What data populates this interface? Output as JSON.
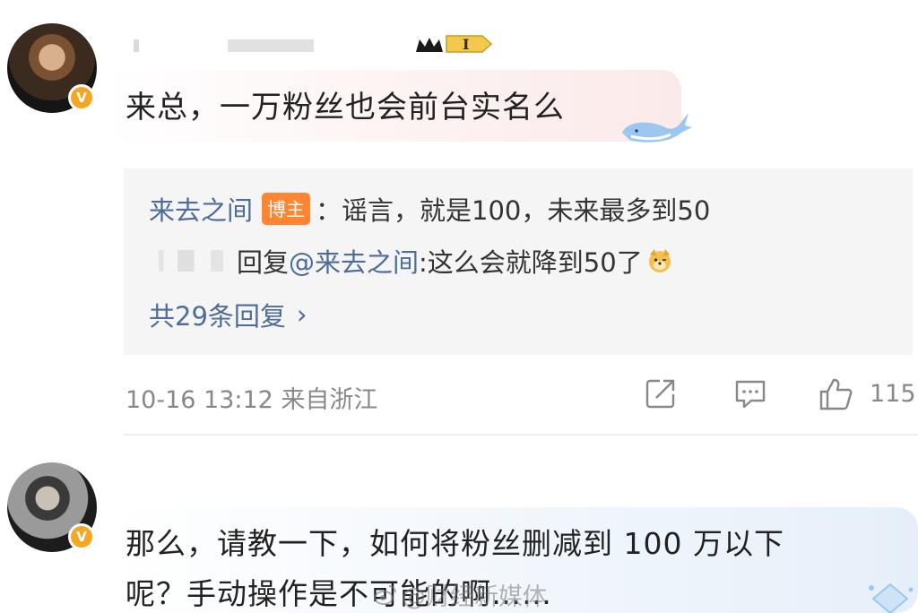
{
  "comment1": {
    "text": "来总，一万粉丝也会前台实名么",
    "badge_level": "I"
  },
  "replies": {
    "line1": {
      "author": "来去之间",
      "tag": "博主",
      "content": "：谣言，就是100，未来最多到50"
    },
    "line2": {
      "prefix": "回复",
      "mention": "@来去之间",
      "content": ":这么会就降到50了"
    },
    "more": {
      "label": "共29条回复",
      "chevron": "›"
    }
  },
  "meta": {
    "time_location": "10-16 13:12  来自浙江",
    "like_count": "115"
  },
  "comment2": {
    "line1": "那么，请教一下，如何将粉丝删减到 100 万以下",
    "line2": "呢？手动操作是不可能的啊……"
  },
  "watermark": {
    "text": "@财经新媒体"
  },
  "colors": {
    "link_blue": "#4d6c99",
    "tag_orange": "#ff8533",
    "verified_orange": "#f5a623",
    "meta_gray": "#888888",
    "reply_bg": "#f5f5f5"
  },
  "icons": [
    "share-icon",
    "comment-icon",
    "like-icon",
    "verified-icon",
    "crown-badge-icon",
    "whale-icon",
    "dog-emoji-icon"
  ]
}
